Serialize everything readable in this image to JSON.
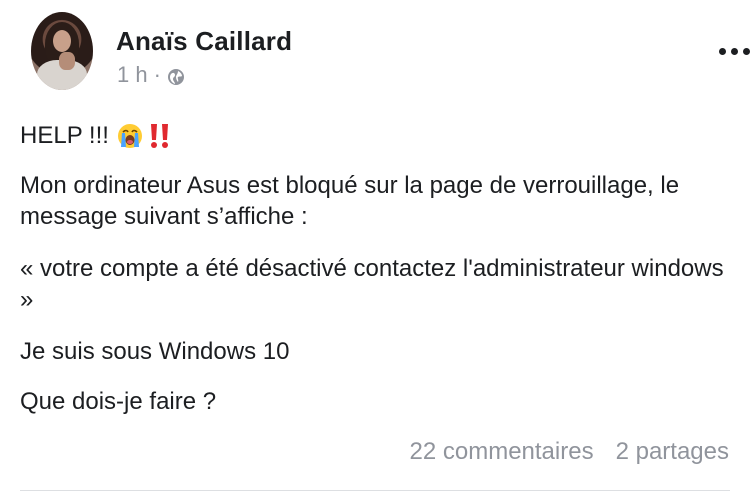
{
  "post": {
    "author": "Anaïs Caillard",
    "time": "1 h",
    "separator": "·",
    "privacy_icon": "globe-icon",
    "more_icon": "more-options-icon",
    "paragraphs": {
      "p1": "HELP !!!",
      "p2": "Mon ordinateur Asus est bloqué sur la page de verrouillage, le message suivant s’affiche :",
      "p3": "« votre compte a été désactivé contactez l'administrateur windows »",
      "p4": "Je suis sous Windows 10",
      "p5": "Que dois-je faire ?"
    },
    "emojis": [
      "loudly-crying-face-icon",
      "double-exclamation-icon"
    ],
    "comments": "22 commentaires",
    "shares": "2 partages"
  },
  "colors": {
    "text": "#1c1e21",
    "muted": "#90949c",
    "divider": "#dddfe2",
    "exclamation": "#e0292f"
  }
}
